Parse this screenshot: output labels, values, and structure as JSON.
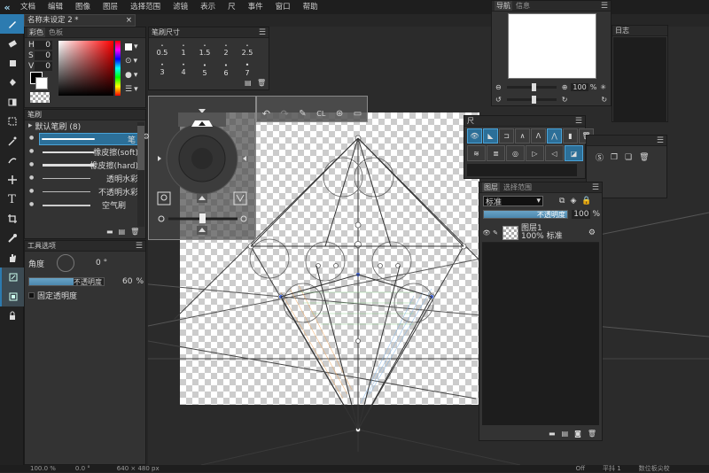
{
  "menu": {
    "items": [
      "文档",
      "编辑",
      "图像",
      "图层",
      "选择范围",
      "滤镜",
      "表示",
      "尺",
      "事件",
      "窗口",
      "帮助"
    ]
  },
  "document_tab": {
    "title": "名称未设定 2 *",
    "close": "×"
  },
  "color_panel": {
    "tabs": [
      "彩色",
      "色板"
    ],
    "labels": {
      "h": "H",
      "s": "S",
      "v": "V"
    },
    "values": {
      "h": "0",
      "s": "0",
      "v": "0"
    }
  },
  "brush_size_panel": {
    "title": "笔刷尺寸",
    "sizes": [
      "0.5",
      "1",
      "1.5",
      "2",
      "2.5",
      "3",
      "4",
      "5",
      "6",
      "7"
    ]
  },
  "brush_panel": {
    "title": "笔刷",
    "group": "默认笔刷 (8)",
    "items": [
      "笔",
      "橡皮擦(soft)",
      "橡皮擦(hard)",
      "透明水彩",
      "不透明水彩",
      "空气刷"
    ]
  },
  "tool_options": {
    "title": "工具选项",
    "angle_label": "角度",
    "angle_value": "0 °",
    "opacity_label": "不透明度",
    "opacity_value": "60",
    "opacity_unit": "%",
    "opacity_level": 0.6,
    "keep_opacity_label": "固定透明度"
  },
  "navigator": {
    "tabs": [
      "导航",
      "信息"
    ],
    "zoom": "100",
    "zoom_unit": "%"
  },
  "log_panel": {
    "title": "日志"
  },
  "ruler_panel": {
    "title": "尺"
  },
  "layer_panel": {
    "tabs": [
      "图层",
      "选择范围"
    ],
    "blend_mode": "标准",
    "opacity_label": "不透明度",
    "opacity_value": "100",
    "opacity_unit": "%",
    "layers": [
      {
        "name": "图层1",
        "info": "100% 标准"
      }
    ]
  },
  "statusbar": {
    "zoom": "100.0 %",
    "rotation": "0.0 °",
    "size": "640 × 480 px",
    "off": "Off",
    "smooth": "平抖 1",
    "digital_corrector": "数位板尖校"
  },
  "colors": {
    "accent": "#2c7bb0",
    "panel": "#333333",
    "bg": "#262626",
    "cursor": "#40a4d8"
  }
}
